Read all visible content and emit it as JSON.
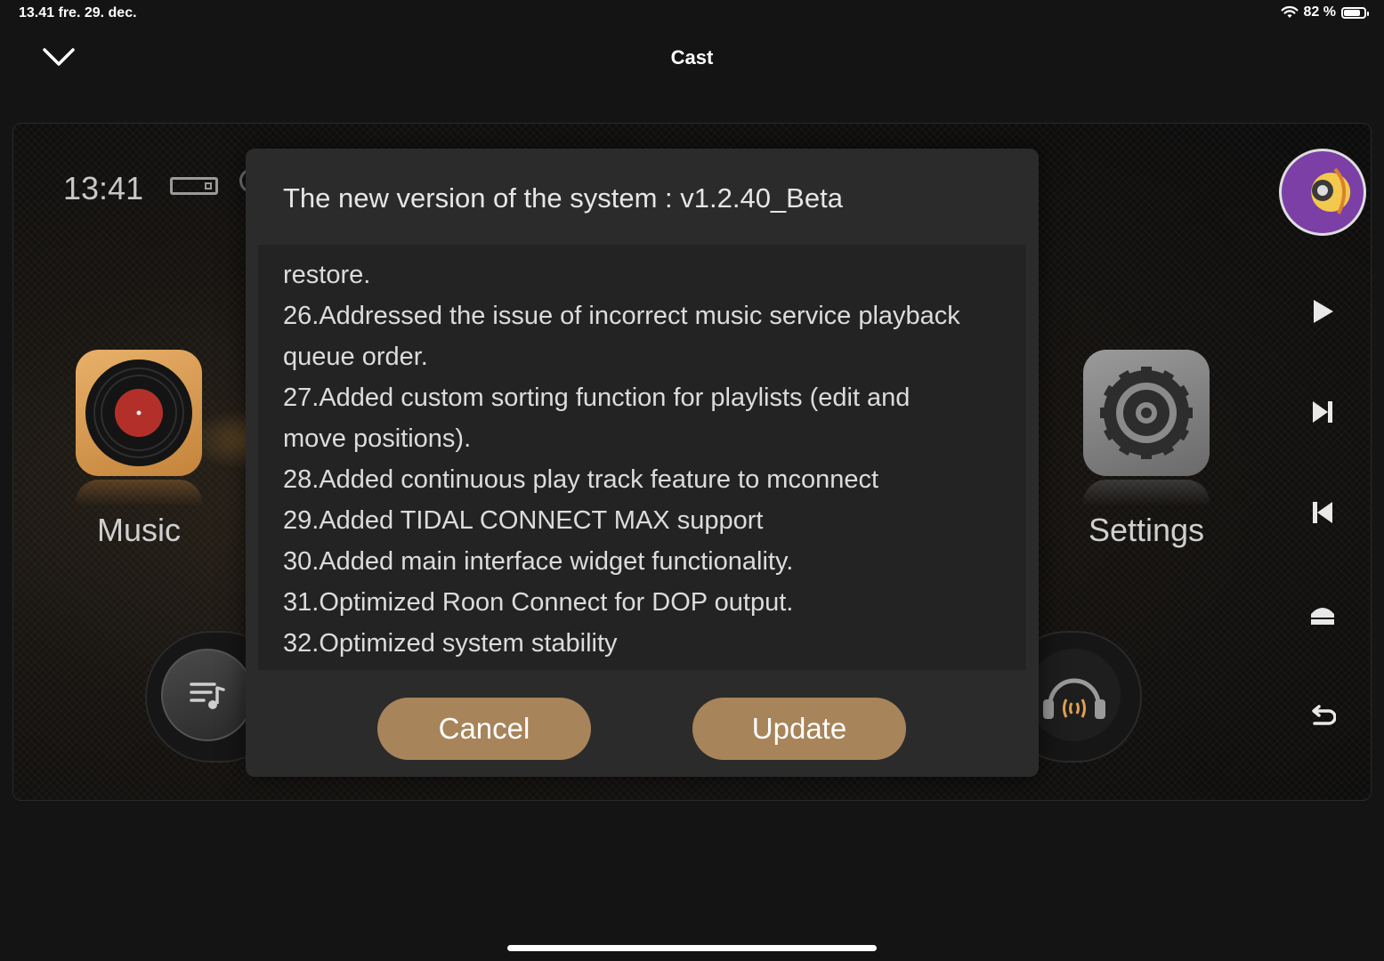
{
  "status_bar": {
    "time_date": "13.41   fre. 29. dec.",
    "battery_text": "82 %",
    "battery_level": 0.82
  },
  "header": {
    "title": "Cast",
    "collapse_icon": "chevron-down-icon"
  },
  "device": {
    "time": "13:41",
    "apps": [
      {
        "label": "Music",
        "icon": "vinyl-record-icon"
      },
      {
        "label": "Settings",
        "icon": "gear-icon"
      }
    ],
    "side_controls": [
      "play-icon",
      "skip-next-icon",
      "skip-previous-icon",
      "home-icon",
      "back-icon"
    ]
  },
  "dialog": {
    "title": "The new version of the system :  v1.2.40_Beta",
    "notes": [
      "restore.",
      "26.Addressed the issue of incorrect music service playback",
      "queue order.",
      "27.Added custom sorting function for playlists (edit and",
      "move positions).",
      "28.Added continuous play track feature to mconnect",
      "29.Added TIDAL CONNECT  MAX support",
      "30.Added main interface widget functionality.",
      "31.Optimized Roon Connect for DOP output.",
      "32.Optimized system stability"
    ],
    "cancel_label": "Cancel",
    "update_label": "Update",
    "button_color": "#a8845a"
  }
}
